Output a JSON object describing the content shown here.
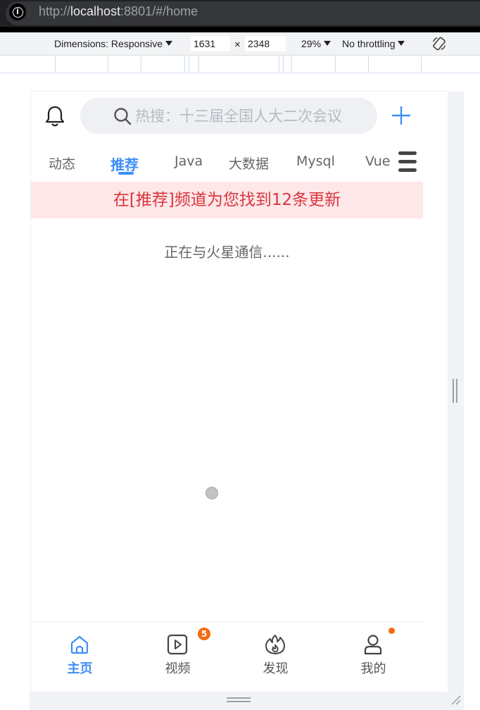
{
  "browser": {
    "url_scheme": "http://",
    "url_host": "localhost",
    "url_rest": ":8801/#/home"
  },
  "devtools": {
    "dimensions_label": "Dimensions: Responsive",
    "width": "1631",
    "height": "2348",
    "zoom": "29%",
    "throttling": "No throttling"
  },
  "header": {
    "search_placeholder": "热搜：十三届全国人大二次会议"
  },
  "channels": [
    {
      "label": "动态"
    },
    {
      "label": "推荐",
      "active": true
    },
    {
      "label": "Java"
    },
    {
      "label": "大数据"
    },
    {
      "label": "Mysql"
    },
    {
      "label": "Vue"
    }
  ],
  "notice": "在[推荐]频道为您找到12条更新",
  "loading_text": "正在与火星通信......",
  "tabbar": [
    {
      "label": "主页",
      "icon": "home-icon",
      "active": true
    },
    {
      "label": "视频",
      "icon": "video-icon",
      "badge": "5"
    },
    {
      "label": "发现",
      "icon": "fire-icon"
    },
    {
      "label": "我的",
      "icon": "user-icon",
      "dot": true
    }
  ],
  "colors": {
    "accent": "#3e8ef7",
    "notice_bg": "#fde7e8",
    "notice_text": "#d9363e",
    "badge": "#f56a10"
  }
}
